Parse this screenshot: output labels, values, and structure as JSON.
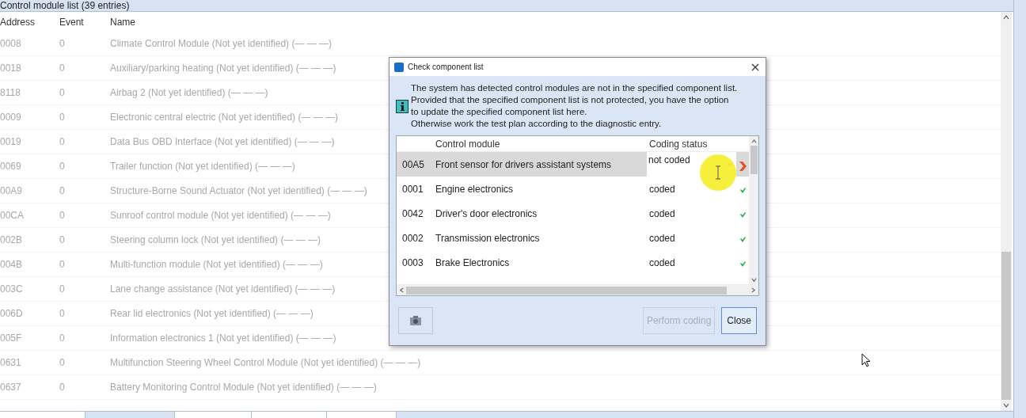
{
  "list": {
    "title": "Control module list (39 entries)",
    "columns": [
      "Address",
      "Event",
      "Name"
    ],
    "rows": [
      {
        "address": "0008",
        "event": "0",
        "name": "Climate Control Module (Not yet identified) (— — —)"
      },
      {
        "address": "0018",
        "event": "0",
        "name": "Auxiliary/parking heating (Not yet identified) (— — —)"
      },
      {
        "address": "8118",
        "event": "0",
        "name": "Airbag 2 (Not yet identified) (— — —)"
      },
      {
        "address": "0009",
        "event": "0",
        "name": "Electronic central electric (Not yet identified) (— — —)"
      },
      {
        "address": "0019",
        "event": "0",
        "name": "Data Bus OBD Interface (Not yet identified) (— — —)"
      },
      {
        "address": "0069",
        "event": "0",
        "name": "Trailer function (Not yet identified) (— — —)"
      },
      {
        "address": "00A9",
        "event": "0",
        "name": "Structure-Borne Sound Actuator (Not yet identified) (— — —)"
      },
      {
        "address": "00CA",
        "event": "0",
        "name": "Sunroof control module (Not yet identified) (— — —)"
      },
      {
        "address": "002B",
        "event": "0",
        "name": "Steering column lock (Not yet identified) (— — —)"
      },
      {
        "address": "004B",
        "event": "0",
        "name": "Multi-function module (Not yet identified) (— — —)"
      },
      {
        "address": "003C",
        "event": "0",
        "name": "Lane change assistance (Not yet identified) (— — —)"
      },
      {
        "address": "006D",
        "event": "0",
        "name": "Rear lid electronics (Not yet identified) (— — —)"
      },
      {
        "address": "005F",
        "event": "0",
        "name": "Information electronics 1 (Not yet identified) (— — —)"
      },
      {
        "address": "0631",
        "event": "0",
        "name": "Multifunction Steering Wheel Control Module (Not yet identified) (— — —)"
      },
      {
        "address": "0637",
        "event": "0",
        "name": "Battery Monitoring Control Module (Not yet identified) (— — —)"
      }
    ]
  },
  "dialog": {
    "title": "Check component list",
    "message": [
      "The system has detected control modules are not in the specified component list.",
      "Provided that the specified component list is not protected, you have the option",
      "to update the specified component list here.",
      "Otherwise work the test plan according to the diagnostic entry."
    ],
    "columns": [
      "Control module",
      "Coding status"
    ],
    "rows": [
      {
        "address": "00A5",
        "name": "Front sensor for drivers assistant systems",
        "status": "not coded",
        "kind": "dropdown",
        "selected": true,
        "ok": false
      },
      {
        "address": "0001",
        "name": "Engine electronics",
        "status": "coded",
        "kind": "plain",
        "selected": false,
        "ok": true
      },
      {
        "address": "0042",
        "name": "Driver's door electronics",
        "status": "coded",
        "kind": "plain",
        "selected": false,
        "ok": true
      },
      {
        "address": "0002",
        "name": "Transmission electronics",
        "status": "coded",
        "kind": "plain",
        "selected": false,
        "ok": true
      },
      {
        "address": "0003",
        "name": "Brake Electronics",
        "status": "coded",
        "kind": "plain",
        "selected": false,
        "ok": true
      }
    ],
    "buttons": [
      {
        "label": "Perform coding",
        "disabled": true
      },
      {
        "label": "Close",
        "disabled": false
      }
    ]
  }
}
